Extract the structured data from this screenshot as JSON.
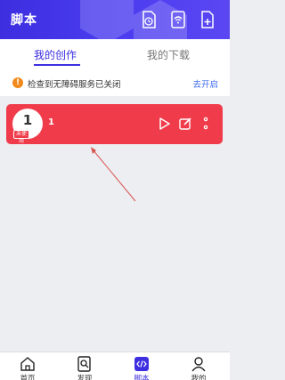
{
  "header": {
    "title": "脚本",
    "icons": [
      "document-clock-icon",
      "wifi-document-icon",
      "add-document-icon"
    ]
  },
  "tabs": {
    "active": "我的创作",
    "inactive": "我的下载"
  },
  "notice": {
    "icon": "warning-icon",
    "text": "检查到无障碍服务已关闭",
    "link": "去开启"
  },
  "script_card": {
    "avatar_number": "1",
    "badge": "未使用",
    "name": "1",
    "color": "#ef3b4a",
    "icons": [
      "play-icon",
      "edit-icon",
      "more-icon"
    ]
  },
  "bottom_nav": {
    "items": [
      {
        "label": "首页",
        "icon": "home-icon"
      },
      {
        "label": "发现",
        "icon": "discover-icon"
      },
      {
        "label": "脚本",
        "icon": "code-icon"
      },
      {
        "label": "我的",
        "icon": "profile-icon"
      }
    ],
    "active_index": 2
  },
  "colors": {
    "accent": "#3d2fe0",
    "card": "#ef3b4a",
    "warning": "#f08a1c",
    "annotation_arrow": "#d9534f"
  }
}
